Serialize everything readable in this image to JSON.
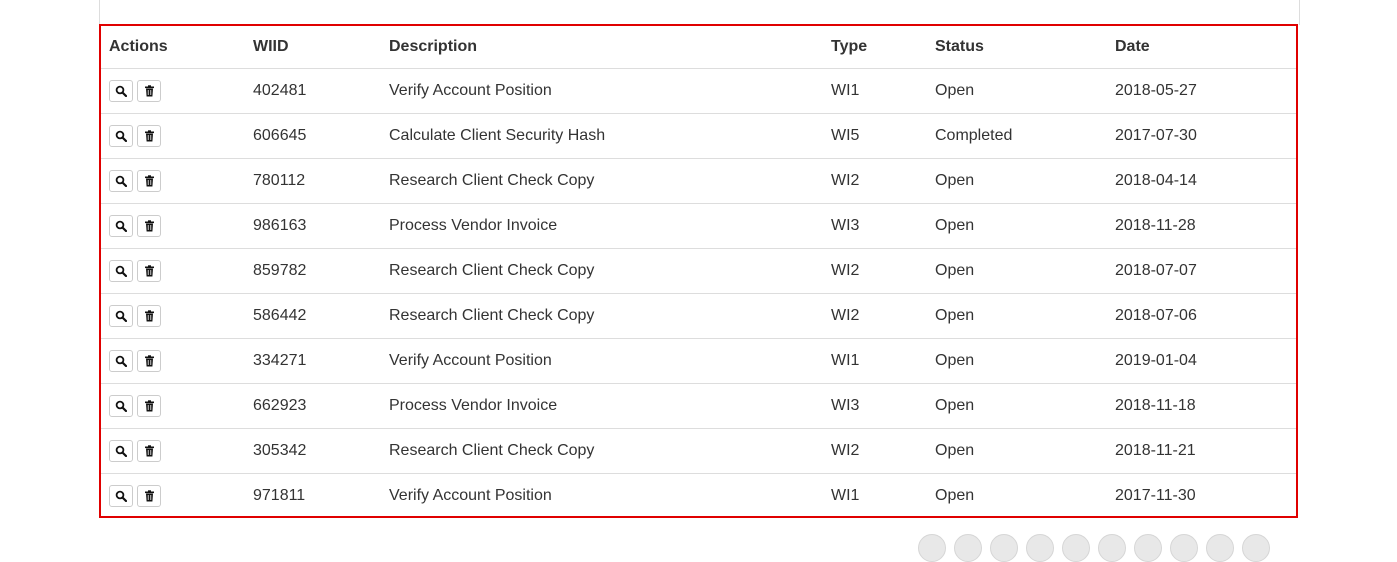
{
  "table": {
    "headers": [
      "Actions",
      "WIID",
      "Description",
      "Type",
      "Status",
      "Date"
    ],
    "rows": [
      {
        "wiid": "402481",
        "description": "Verify Account Position",
        "type": "WI1",
        "status": "Open",
        "date": "2018-05-27"
      },
      {
        "wiid": "606645",
        "description": "Calculate Client Security Hash",
        "type": "WI5",
        "status": "Completed",
        "date": "2017-07-30"
      },
      {
        "wiid": "780112",
        "description": "Research Client Check Copy",
        "type": "WI2",
        "status": "Open",
        "date": "2018-04-14"
      },
      {
        "wiid": "986163",
        "description": "Process Vendor Invoice",
        "type": "WI3",
        "status": "Open",
        "date": "2018-11-28"
      },
      {
        "wiid": "859782",
        "description": "Research Client Check Copy",
        "type": "WI2",
        "status": "Open",
        "date": "2018-07-07"
      },
      {
        "wiid": "586442",
        "description": "Research Client Check Copy",
        "type": "WI2",
        "status": "Open",
        "date": "2018-07-06"
      },
      {
        "wiid": "334271",
        "description": "Verify Account Position",
        "type": "WI1",
        "status": "Open",
        "date": "2019-01-04"
      },
      {
        "wiid": "662923",
        "description": "Process Vendor Invoice",
        "type": "WI3",
        "status": "Open",
        "date": "2018-11-18"
      },
      {
        "wiid": "305342",
        "description": "Research Client Check Copy",
        "type": "WI2",
        "status": "Open",
        "date": "2018-11-21"
      },
      {
        "wiid": "971811",
        "description": "Verify Account Position",
        "type": "WI1",
        "status": "Open",
        "date": "2017-11-30"
      }
    ],
    "row_actions": [
      "search-icon",
      "trash-icon"
    ]
  },
  "colors": {
    "highlight_border": "#e00000",
    "row_border": "#dddddd"
  }
}
